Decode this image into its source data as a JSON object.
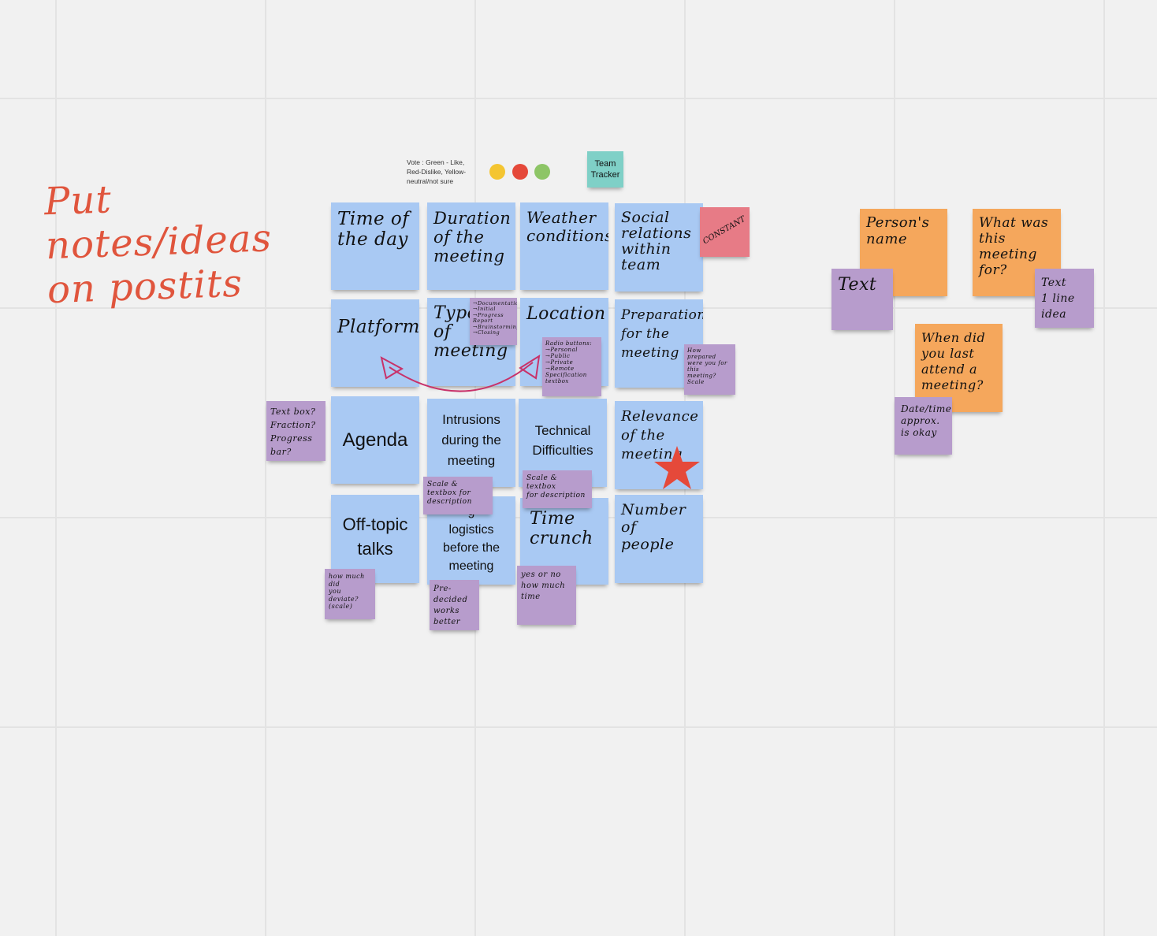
{
  "board": {
    "headline": "Put notes/ideas\non postits",
    "vote_legend": "Vote : Green - Like,\nRed-Dislike, Yellow-\nneutral/not sure",
    "vote_dots": {
      "yellow": "#f4c531",
      "red": "#e5493a",
      "green": "#8dc566"
    },
    "team_tracker": "Team\nTracker",
    "constant_tag": "CONSTANT",
    "colors": {
      "blue": "#a9c9f3",
      "purple": "#b79ccc",
      "orange": "#f5a75c",
      "pink": "#e77b86",
      "teal": "#7fd0c7",
      "arrow": "#c8326a",
      "star": "#e5493a"
    }
  },
  "grid_notes": {
    "time_of_day": "Time of\nthe day",
    "duration": "Duration\nof the\nmeeting",
    "weather": "Weather\nconditions",
    "social": "Social\nrelations\nwithin\nteam",
    "platform": "Platform",
    "type_of_meeting": "Type\nof\nmeeting",
    "location": "Location",
    "preparation": "Preparation\nfor the\nmeeting",
    "agenda": "Agenda",
    "intrusions": "Intrusions\nduring the\nmeeting",
    "technical": "Technical\nDifficulties",
    "relevance": "Relevance\nof the\nmeeting",
    "off_topic": "Off-topic\ntalks",
    "logistics": "g\nlogistics\nbefore the\nmeeting",
    "time_crunch": "Time\ncrunch",
    "number_people": "Number of\npeople"
  },
  "comments": {
    "type_list": "→Documentation\n→Initial\n→Progress Report\n→Brainstorming\n→Closing",
    "radio": "Radio buttons:\n→Personal\n→Public\n→Private\n→Remote\nSpecification\ntextbox",
    "prepared": "How prepared\nwere you for this\nmeeting?\nScale",
    "agenda_side": "Text box?\nFraction?\nProgress bar?",
    "intrusions_scale": "Scale & textbox for\ndescription",
    "technical_scale": "Scale & textbox\nfor description",
    "deviate": "how much did\nyou deviate?\n(scale)",
    "predecided": "Pre-decided\nworks\nbetter",
    "yes_no": "yes or no\nhow much\ntime"
  },
  "side_notes": {
    "person_name": "Person's\nname",
    "text_a": "Text",
    "what_for": "What was\nthis meeting\nfor?",
    "text_b": "Text\n1 line idea",
    "last_attend": "When did\nyou last\nattend a\nmeeting?",
    "date_time": "Date/time\napprox.\nis okay"
  }
}
